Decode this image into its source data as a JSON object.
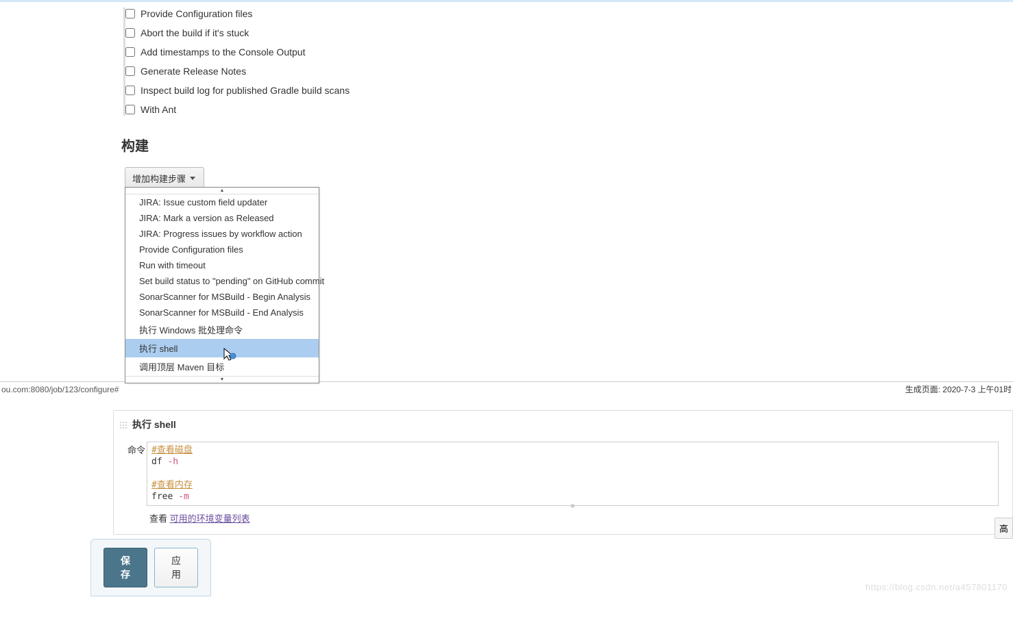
{
  "checkboxes": {
    "provide_config": "Provide Configuration files",
    "abort_stuck": "Abort the build if it's stuck",
    "timestamps": "Add timestamps to the Console Output",
    "release_notes": "Generate Release Notes",
    "inspect_gradle": "Inspect build log for published Gradle build scans",
    "with_ant": "With Ant"
  },
  "sections": {
    "build_title": "构建"
  },
  "buttons": {
    "add_build_step": "增加构建步骤",
    "add_build_step_2": "增加构建步骤",
    "save": "保存",
    "apply": "应用",
    "advanced": "高"
  },
  "dropdown": {
    "items": [
      "JIRA: Issue custom field updater",
      "JIRA: Mark a version as Released",
      "JIRA: Progress issues by workflow action",
      "Provide Configuration files",
      "Run with timeout",
      "Set build status to \"pending\" on GitHub commit",
      "SonarScanner for MSBuild - Begin Analysis",
      "SonarScanner for MSBuild - End Analysis",
      "执行 Windows 批处理命令",
      "执行 shell",
      "调用顶层 Maven 目标"
    ],
    "highlighted_index": 9
  },
  "status": {
    "url": "ou.com:8080/job/123/configure#",
    "timestamp": "生成页面: 2020-7-3 上午01时"
  },
  "shell_step": {
    "title": "执行 shell",
    "cmd_label": "命令",
    "code": {
      "comment1": "#查看磁盘",
      "line1_cmd": "df",
      "line1_flag": "-h",
      "comment2": "#查看内存",
      "line2_cmd": "free",
      "line2_flag": "-m"
    },
    "env_prefix": "查看",
    "env_link": "可用的环境变量列表"
  },
  "watermark": "https://blog.csdn.net/a457801170"
}
